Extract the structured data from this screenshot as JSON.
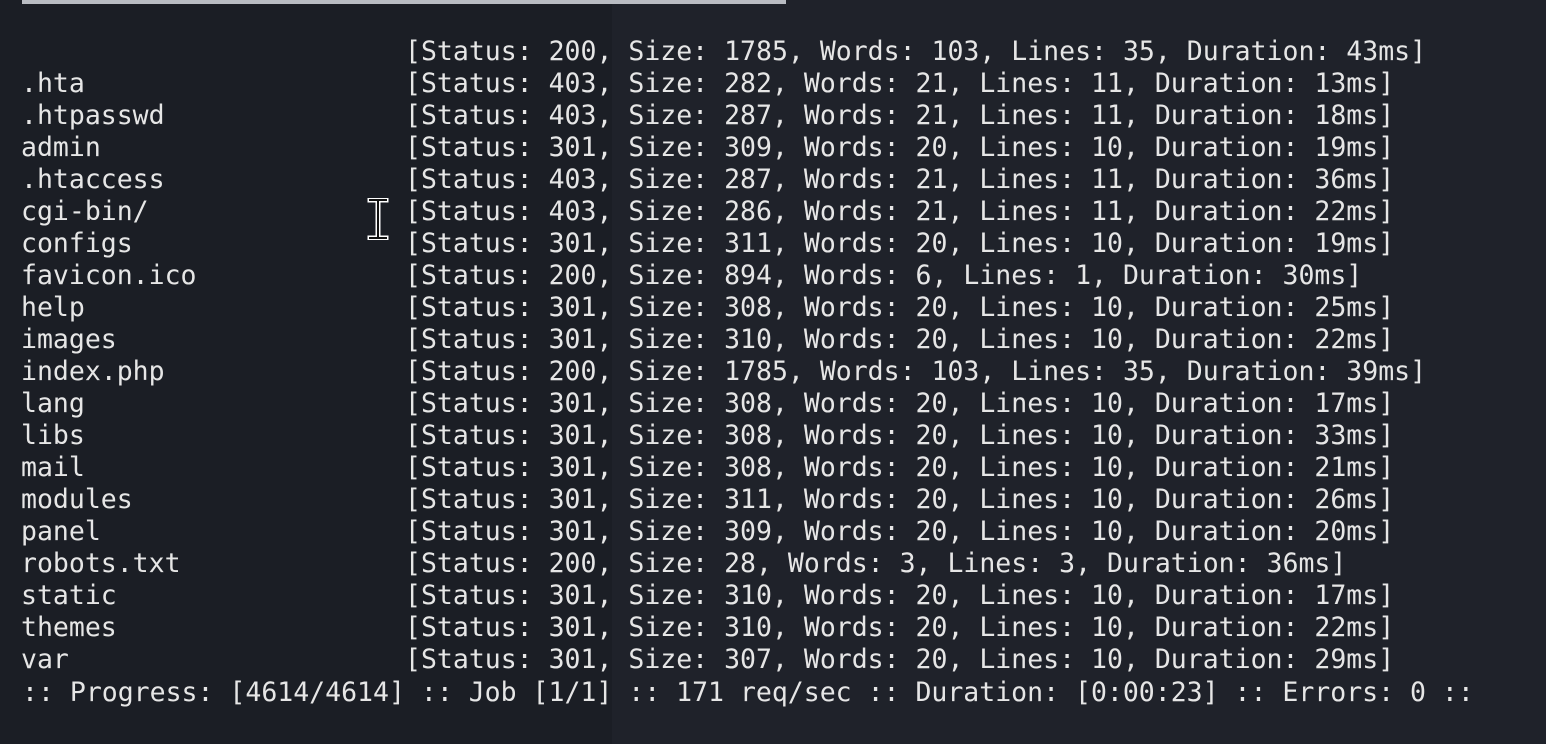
{
  "results": [
    {
      "path": "",
      "stats": "[Status: 200, Size: 1785, Words: 103, Lines: 35, Duration: 43ms]"
    },
    {
      "path": ".hta",
      "stats": "[Status: 403, Size: 282, Words: 21, Lines: 11, Duration: 13ms]"
    },
    {
      "path": ".htpasswd",
      "stats": "[Status: 403, Size: 287, Words: 21, Lines: 11, Duration: 18ms]"
    },
    {
      "path": "admin",
      "stats": "[Status: 301, Size: 309, Words: 20, Lines: 10, Duration: 19ms]"
    },
    {
      "path": ".htaccess",
      "stats": "[Status: 403, Size: 287, Words: 21, Lines: 11, Duration: 36ms]"
    },
    {
      "path": "cgi-bin/",
      "stats": "[Status: 403, Size: 286, Words: 21, Lines: 11, Duration: 22ms]"
    },
    {
      "path": "configs",
      "stats": "[Status: 301, Size: 311, Words: 20, Lines: 10, Duration: 19ms]"
    },
    {
      "path": "favicon.ico",
      "stats": "[Status: 200, Size: 894, Words: 6, Lines: 1, Duration: 30ms]"
    },
    {
      "path": "help",
      "stats": "[Status: 301, Size: 308, Words: 20, Lines: 10, Duration: 25ms]"
    },
    {
      "path": "images",
      "stats": "[Status: 301, Size: 310, Words: 20, Lines: 10, Duration: 22ms]"
    },
    {
      "path": "index.php",
      "stats": "[Status: 200, Size: 1785, Words: 103, Lines: 35, Duration: 39ms]"
    },
    {
      "path": "lang",
      "stats": "[Status: 301, Size: 308, Words: 20, Lines: 10, Duration: 17ms]"
    },
    {
      "path": "libs",
      "stats": "[Status: 301, Size: 308, Words: 20, Lines: 10, Duration: 33ms]"
    },
    {
      "path": "mail",
      "stats": "[Status: 301, Size: 308, Words: 20, Lines: 10, Duration: 21ms]"
    },
    {
      "path": "modules",
      "stats": "[Status: 301, Size: 311, Words: 20, Lines: 10, Duration: 26ms]"
    },
    {
      "path": "panel",
      "stats": "[Status: 301, Size: 309, Words: 20, Lines: 10, Duration: 20ms]"
    },
    {
      "path": "robots.txt",
      "stats": "[Status: 200, Size: 28, Words: 3, Lines: 3, Duration: 36ms]"
    },
    {
      "path": "static",
      "stats": "[Status: 301, Size: 310, Words: 20, Lines: 10, Duration: 17ms]"
    },
    {
      "path": "themes",
      "stats": "[Status: 301, Size: 310, Words: 20, Lines: 10, Duration: 22ms]"
    },
    {
      "path": "var",
      "stats": "[Status: 301, Size: 307, Words: 20, Lines: 10, Duration: 29ms]"
    }
  ],
  "progress_line": ":: Progress: [4614/4614] :: Job [1/1] :: 171 req/sec :: Duration: [0:00:23] :: Errors: 0 ::",
  "cursor_icon": "text-cursor-ibeam",
  "colors": {
    "background": "#1f222a",
    "left_pane": "#1b1e25",
    "text": "#e6e6e6"
  }
}
